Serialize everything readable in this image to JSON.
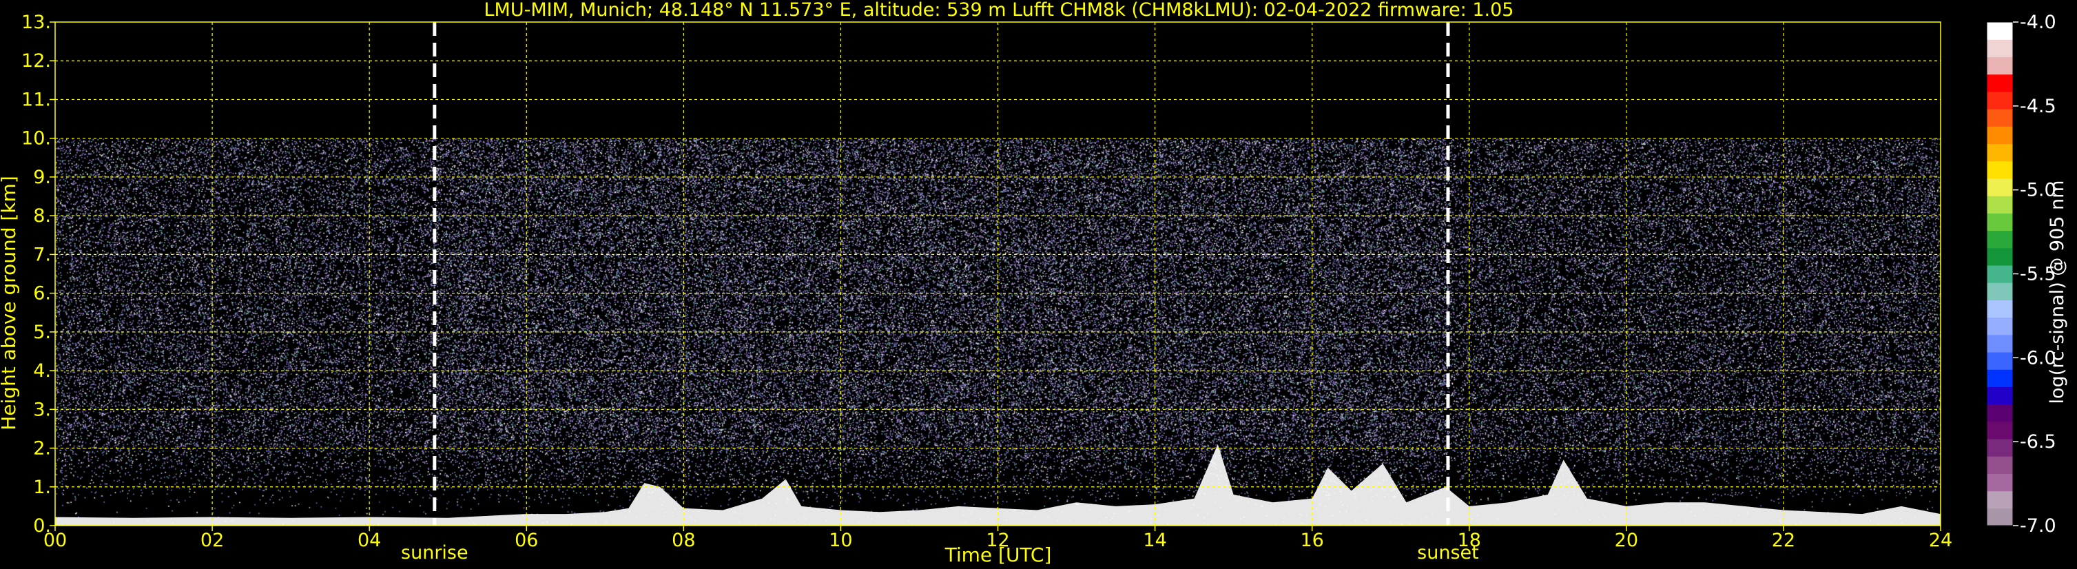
{
  "chart_data": {
    "type": "heatmap",
    "title": "LMU-MIM, Munich; 48.148° N 11.573° E, altitude: 539 m    Lufft CHM8k (CHM8kLMU): 02-04-2022    firmware: 1.05",
    "xlabel": "Time [UTC]",
    "ylabel": "Height above ground [km]",
    "xlim": [
      0,
      24
    ],
    "ylim": [
      0,
      13
    ],
    "grid": true,
    "x_ticks": [
      "00",
      "02",
      "04",
      "06",
      "08",
      "10",
      "12",
      "14",
      "16",
      "18",
      "20",
      "22",
      "24"
    ],
    "y_ticks": [
      "0.",
      "1.",
      "2.",
      "3.",
      "4.",
      "5.",
      "6.",
      "7.",
      "8.",
      "9.",
      "10.",
      "11.",
      "12.",
      "13."
    ],
    "events": [
      {
        "label": "sunrise",
        "time": 4.83
      },
      {
        "label": "sunset",
        "time": 17.73
      }
    ],
    "data_top_km": 10.0,
    "colorbar": {
      "label": "log(rc-signal) @ 905 nm",
      "range": [
        -7.0,
        -4.0
      ],
      "ticks": [
        "-4.0",
        "-4.5",
        "-5.0",
        "-5.5",
        "-6.0",
        "-6.5",
        "-7.0"
      ],
      "colors": [
        "#a895a8",
        "#b9a2b8",
        "#a5699f",
        "#93508d",
        "#7a2a7c",
        "#6b0a6e",
        "#5a0070",
        "#2200c8",
        "#0033ff",
        "#3a66ff",
        "#6e8eff",
        "#95adff",
        "#a9c4ff",
        "#7fc7b8",
        "#45b58b",
        "#13953a",
        "#2aa83a",
        "#68c93c",
        "#aee04a",
        "#eef04f",
        "#ffe000",
        "#ffb600",
        "#ff8c00",
        "#ff5a12",
        "#ff2a10",
        "#ff0000",
        "#e9b3b3",
        "#f0d3d3",
        "#ffffff"
      ]
    },
    "aerosol_profile": [
      {
        "t": 0.0,
        "h": 0.22
      },
      {
        "t": 1.0,
        "h": 0.2
      },
      {
        "t": 2.0,
        "h": 0.22
      },
      {
        "t": 3.0,
        "h": 0.2
      },
      {
        "t": 4.0,
        "h": 0.22
      },
      {
        "t": 5.0,
        "h": 0.2
      },
      {
        "t": 5.5,
        "h": 0.25
      },
      {
        "t": 6.0,
        "h": 0.3
      },
      {
        "t": 6.5,
        "h": 0.3
      },
      {
        "t": 7.0,
        "h": 0.35
      },
      {
        "t": 7.3,
        "h": 0.45
      },
      {
        "t": 7.5,
        "h": 1.1
      },
      {
        "t": 7.7,
        "h": 1.0
      },
      {
        "t": 8.0,
        "h": 0.45
      },
      {
        "t": 8.5,
        "h": 0.4
      },
      {
        "t": 9.0,
        "h": 0.7
      },
      {
        "t": 9.3,
        "h": 1.2
      },
      {
        "t": 9.5,
        "h": 0.5
      },
      {
        "t": 10.0,
        "h": 0.4
      },
      {
        "t": 10.5,
        "h": 0.35
      },
      {
        "t": 11.0,
        "h": 0.4
      },
      {
        "t": 11.5,
        "h": 0.5
      },
      {
        "t": 12.0,
        "h": 0.45
      },
      {
        "t": 12.5,
        "h": 0.4
      },
      {
        "t": 13.0,
        "h": 0.6
      },
      {
        "t": 13.5,
        "h": 0.5
      },
      {
        "t": 14.0,
        "h": 0.55
      },
      {
        "t": 14.5,
        "h": 0.7
      },
      {
        "t": 14.8,
        "h": 2.1
      },
      {
        "t": 15.0,
        "h": 0.8
      },
      {
        "t": 15.5,
        "h": 0.6
      },
      {
        "t": 16.0,
        "h": 0.7
      },
      {
        "t": 16.2,
        "h": 1.5
      },
      {
        "t": 16.5,
        "h": 0.9
      },
      {
        "t": 16.9,
        "h": 1.6
      },
      {
        "t": 17.2,
        "h": 0.6
      },
      {
        "t": 17.7,
        "h": 1.0
      },
      {
        "t": 18.0,
        "h": 0.5
      },
      {
        "t": 18.5,
        "h": 0.6
      },
      {
        "t": 19.0,
        "h": 0.8
      },
      {
        "t": 19.2,
        "h": 1.7
      },
      {
        "t": 19.5,
        "h": 0.7
      },
      {
        "t": 20.0,
        "h": 0.5
      },
      {
        "t": 20.5,
        "h": 0.6
      },
      {
        "t": 21.0,
        "h": 0.6
      },
      {
        "t": 21.5,
        "h": 0.5
      },
      {
        "t": 22.0,
        "h": 0.4
      },
      {
        "t": 22.5,
        "h": 0.35
      },
      {
        "t": 23.0,
        "h": 0.3
      },
      {
        "t": 23.5,
        "h": 0.5
      },
      {
        "t": 24.0,
        "h": 0.3
      }
    ]
  }
}
